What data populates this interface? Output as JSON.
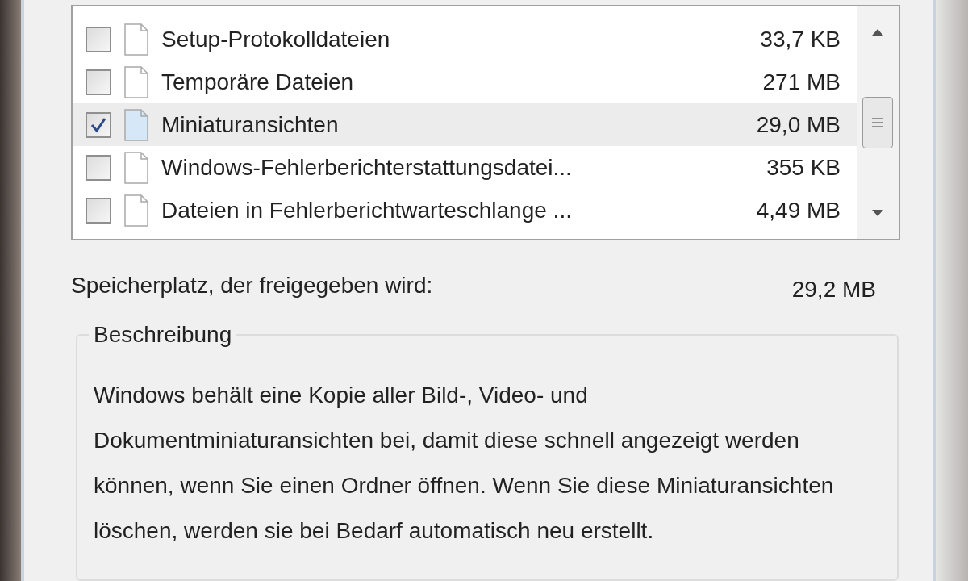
{
  "files": [
    {
      "name": "Setup-Protokolldateien",
      "size": "33,7 KB",
      "checked": false,
      "selected": false
    },
    {
      "name": "Temporäre Dateien",
      "size": "271 MB",
      "checked": false,
      "selected": false
    },
    {
      "name": "Miniaturansichten",
      "size": "29,0 MB",
      "checked": true,
      "selected": true
    },
    {
      "name": "Windows-Fehlerberichterstattungsdatei...",
      "size": "355 KB",
      "checked": false,
      "selected": false
    },
    {
      "name": "Dateien in Fehlerberichtwarteschlange ...",
      "size": "4,49 MB",
      "checked": false,
      "selected": false
    }
  ],
  "free_space": {
    "label": "Speicherplatz, der freigegeben wird:",
    "value": "29,2 MB"
  },
  "description": {
    "title": "Beschreibung",
    "text": "Windows behält eine Kopie aller Bild-, Video- und Dokumentminiaturansichten bei, damit diese schnell angezeigt werden können, wenn Sie einen Ordner öffnen. Wenn Sie diese Miniaturansichten löschen, werden sie bei Bedarf automatisch neu erstellt."
  }
}
